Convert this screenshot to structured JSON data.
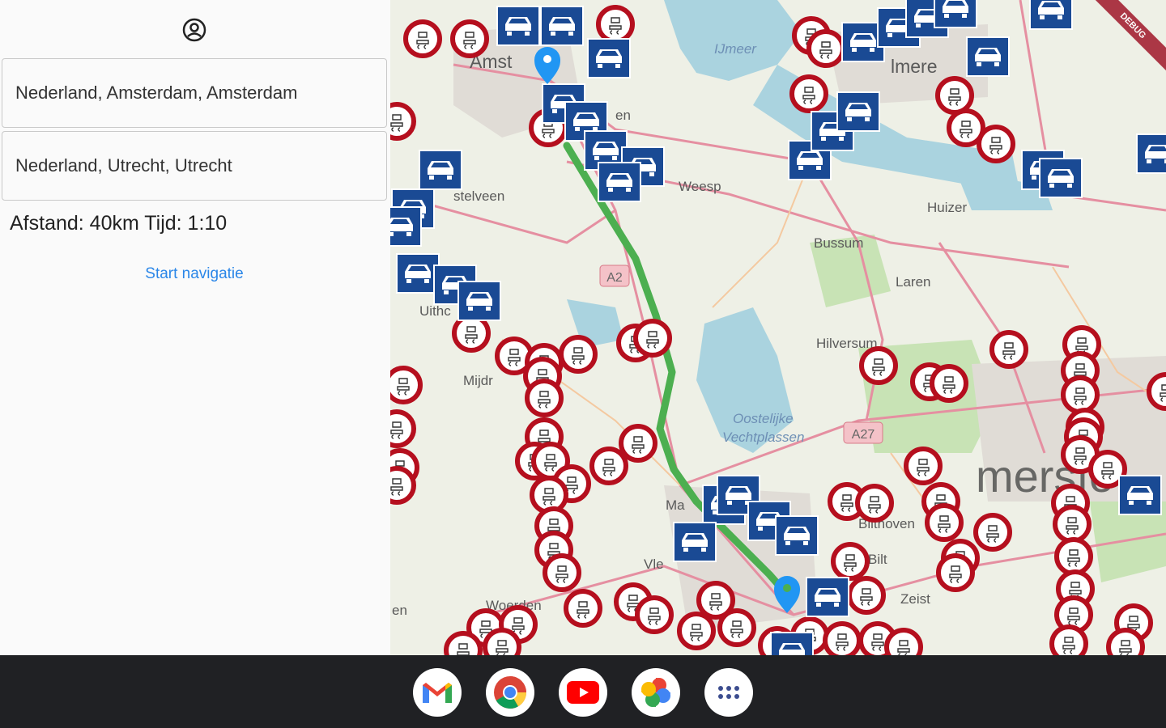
{
  "left_panel": {
    "profile_icon": "account-circle-icon",
    "from_value": "Nederland, Amsterdam, Amsterdam",
    "to_value": "Nederland, Utrecht, Utrecht",
    "distance_info": "Afstand: 40km Tijd: 1:10",
    "start_navigation": "Start navigatie"
  },
  "map": {
    "debug_label": "DEBUG",
    "labels": {
      "amsterdam": "Amst",
      "almere": "lmere",
      "ijmeer": "IJmeer",
      "weesp": "Weesp",
      "huizen": "Huizer",
      "bussum": "Bussum",
      "laren": "Laren",
      "amstelveen": "stelveen",
      "a2": "A2",
      "uithoorn": "Uithc",
      "mijdrecht": "Mijdr",
      "hilversum": "Hilversum",
      "oostelijke": "Oostelijke",
      "vechtplassen": "Vechtplassen",
      "a27": "A27",
      "bilthoven": "Bilthoven",
      "bilt": "Bilt",
      "zeist": "Zeist",
      "woerden": "Woerden",
      "en": "en",
      "vleuten": "Vle",
      "diemen": "en",
      "maarssen": "Ma",
      "amersfoort": "mersfo"
    },
    "colors": {
      "route": "#4caf50",
      "speed_camera_ring": "#b50f1e",
      "car_marker": "#1a4a94",
      "pin": "#2196f3"
    }
  },
  "taskbar": {
    "apps": [
      "gmail-icon",
      "chrome-icon",
      "youtube-icon",
      "google-photos-icon",
      "app-launcher-icon"
    ]
  }
}
